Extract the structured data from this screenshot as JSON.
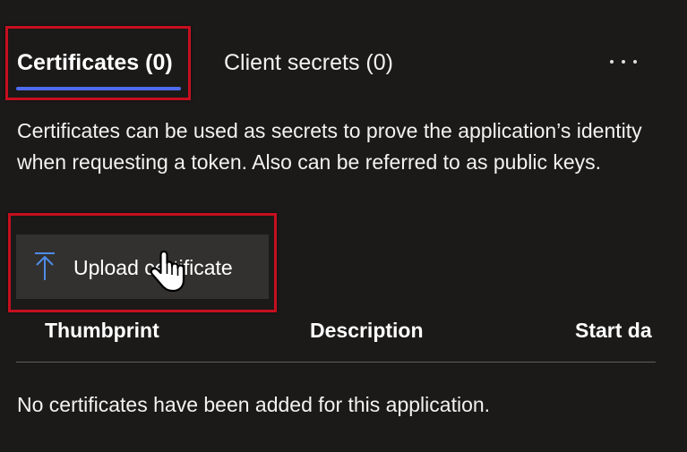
{
  "tabs": [
    {
      "label": "Certificates (0)",
      "selected": true
    },
    {
      "label": "Client secrets (0)",
      "selected": false
    }
  ],
  "more_options_icon": "ellipsis-icon",
  "description": "Certificates can be used as secrets to prove the application’s identity when requesting a token. Also can be referred to as public keys.",
  "upload_button": {
    "label": "Upload certificate",
    "icon": "upload-arrow-icon"
  },
  "table": {
    "columns": [
      "Thumbprint",
      "Description",
      "Start da"
    ],
    "empty_message": "No certificates have been added for this application."
  },
  "colors": {
    "background": "#1b1a19",
    "accent": "#4f6bed",
    "highlight": "#c50f1f",
    "button_bg": "#323130"
  }
}
